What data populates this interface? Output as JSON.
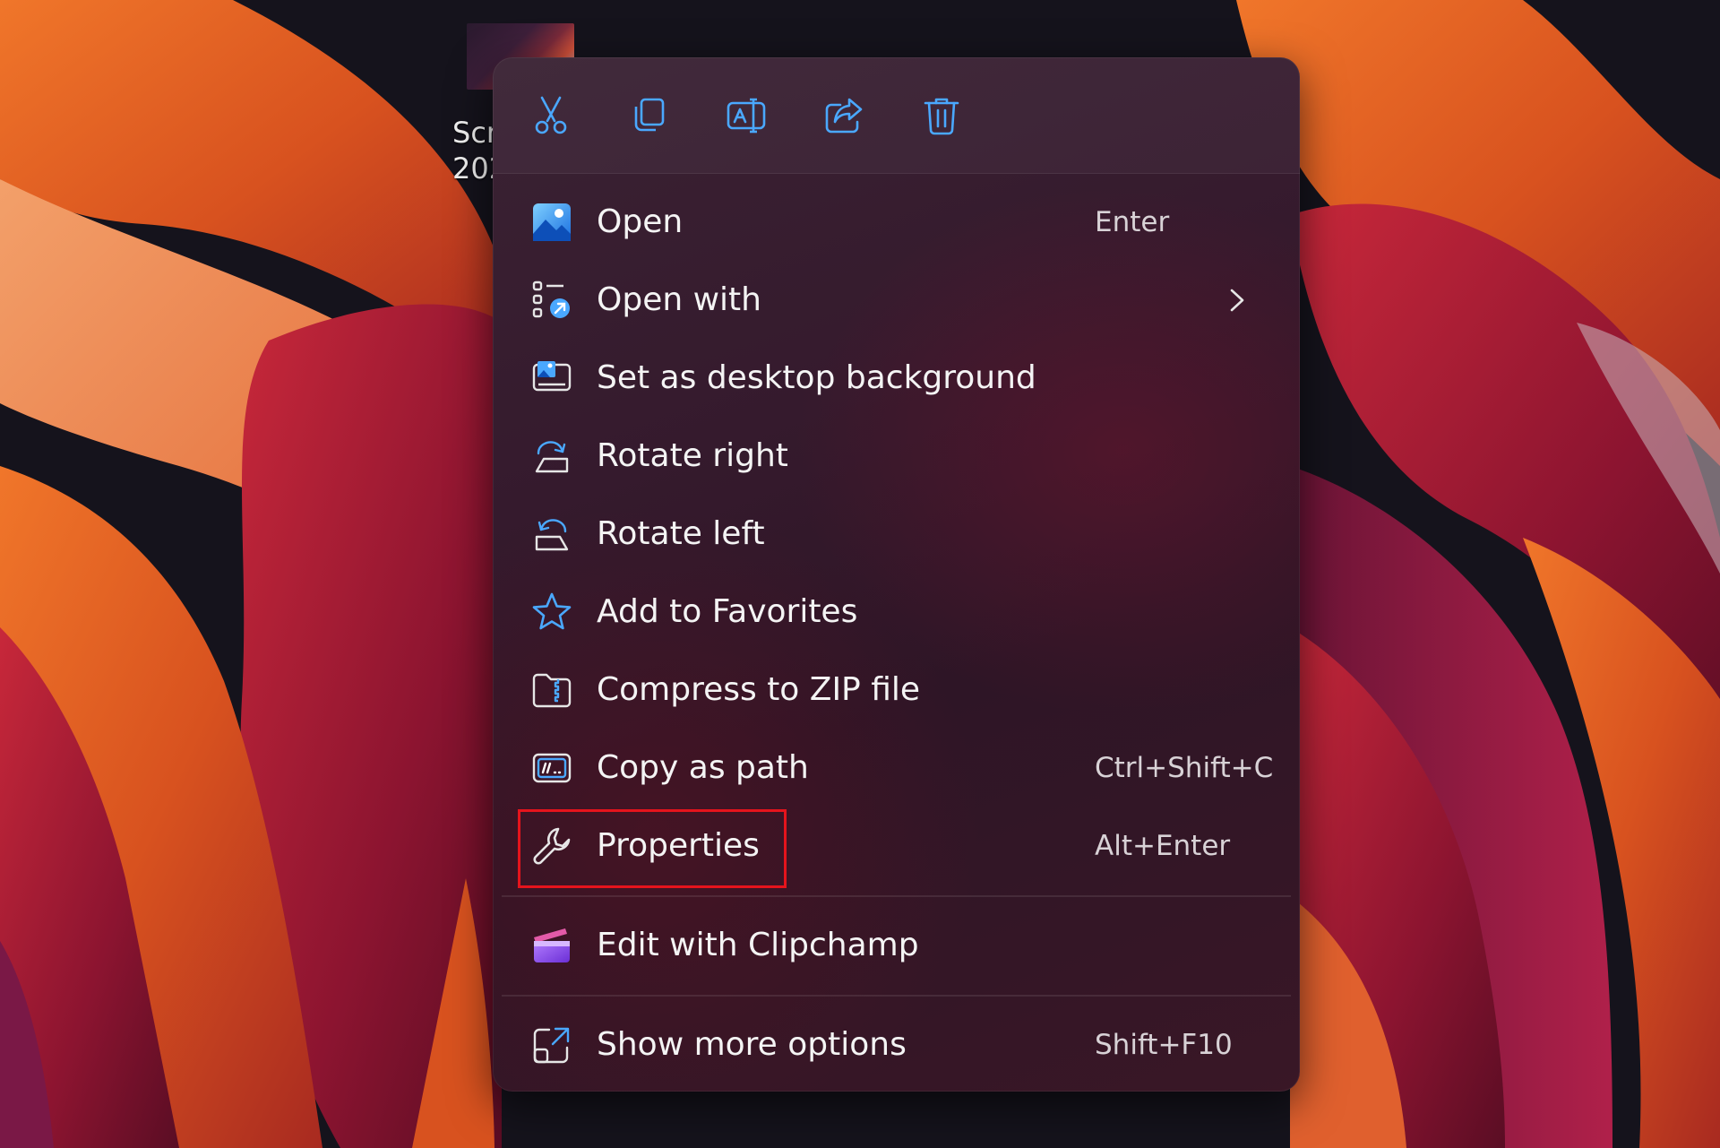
{
  "desktop": {
    "icon_label_line1": "Scr",
    "icon_label_line2": "202"
  },
  "toolbar": {
    "buttons": [
      {
        "name": "cut",
        "icon": "scissors-icon"
      },
      {
        "name": "copy",
        "icon": "copy-icon"
      },
      {
        "name": "rename",
        "icon": "rename-icon"
      },
      {
        "name": "share",
        "icon": "share-icon"
      },
      {
        "name": "delete",
        "icon": "trash-icon"
      }
    ]
  },
  "menu": {
    "items": [
      {
        "label": "Open",
        "shortcut": "Enter",
        "icon": "photos-app-icon"
      },
      {
        "label": "Open with",
        "shortcut": "",
        "icon": "open-with-icon",
        "submenu": true
      },
      {
        "label": "Set as desktop background",
        "shortcut": "",
        "icon": "desktop-background-icon"
      },
      {
        "label": "Rotate right",
        "shortcut": "",
        "icon": "rotate-right-icon"
      },
      {
        "label": "Rotate left",
        "shortcut": "",
        "icon": "rotate-left-icon"
      },
      {
        "label": "Add to Favorites",
        "shortcut": "",
        "icon": "star-icon"
      },
      {
        "label": "Compress to ZIP file",
        "shortcut": "",
        "icon": "zip-folder-icon"
      },
      {
        "label": "Copy as path",
        "shortcut": "Ctrl+Shift+C",
        "icon": "copy-path-icon"
      },
      {
        "label": "Properties",
        "shortcut": "Alt+Enter",
        "icon": "wrench-icon"
      },
      {
        "label": "Edit with Clipchamp",
        "shortcut": "",
        "icon": "clipchamp-icon"
      },
      {
        "label": "Show more options",
        "shortcut": "Shift+F10",
        "icon": "show-more-options-icon"
      }
    ]
  },
  "colors": {
    "accent": "#4aa8ff",
    "highlight_border": "#e5141c",
    "text": "#f4f4f4"
  }
}
